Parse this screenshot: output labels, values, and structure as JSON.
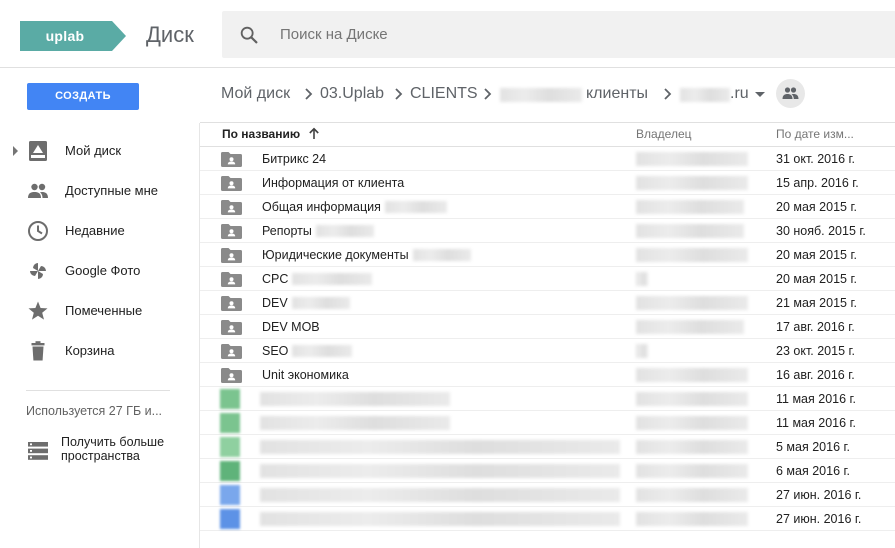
{
  "header": {
    "logo_text": "uplab",
    "app_title": "Диск",
    "search_placeholder": "Поиск на Диске",
    "colors": {
      "logo": "#5aaba5",
      "primary": "#4285f4",
      "icon": "#757575"
    }
  },
  "create_button": "СОЗДАТЬ",
  "sidebar": {
    "items": [
      {
        "label": "Мой диск",
        "icon": "drive-icon"
      },
      {
        "label": "Доступные мне",
        "icon": "shared-people-icon"
      },
      {
        "label": "Недавние",
        "icon": "clock-icon"
      },
      {
        "label": "Google Фото",
        "icon": "photos-pinwheel-icon"
      },
      {
        "label": "Помеченные",
        "icon": "star-icon"
      },
      {
        "label": "Корзина",
        "icon": "trash-icon"
      }
    ],
    "storage_text": "Используется 27 ГБ и...",
    "upgrade_label": "Получить больше пространства"
  },
  "breadcrumb": {
    "items": [
      "Мой диск",
      "03.Uplab",
      "CLIENTS",
      "клиенты",
      ".ru"
    ]
  },
  "list": {
    "headers": {
      "name": "По названию",
      "owner": "Владелец",
      "date": "По дате изм..."
    },
    "folders": [
      {
        "name": "Битрикс 24",
        "date": "31 окт. 2016 г."
      },
      {
        "name": "Информация от клиента",
        "date": "15 апр. 2016 г."
      },
      {
        "name": "Общая информация",
        "date": "20 мая 2015 г."
      },
      {
        "name": "Репорты",
        "date": "30 нояб. 2015 г."
      },
      {
        "name": "Юридические документы",
        "date": "20 мая 2015 г."
      },
      {
        "name": "CPC",
        "date": "20 мая 2015 г."
      },
      {
        "name": "DEV",
        "date": "21 мая 2015 г."
      },
      {
        "name": "DEV MOB",
        "date": "17 авг. 2016 г."
      },
      {
        "name": "SEO",
        "date": "23 окт. 2015 г."
      },
      {
        "name": "Unit экономика",
        "date": "16 авг. 2016 г."
      }
    ],
    "files": [
      {
        "date": "11 мая 2016 г.",
        "thumb": "#7bc48f"
      },
      {
        "date": "11 мая 2016 г.",
        "thumb": "#7bc48f"
      },
      {
        "date": "5 мая 2016 г.",
        "thumb": "#8fd0a0"
      },
      {
        "date": "6 мая 2016 г.",
        "thumb": "#5fb37a"
      },
      {
        "date": "27 июн. 2016 г.",
        "thumb": "#7aa7ec"
      },
      {
        "date": "27 июн. 2016 г.",
        "thumb": "#5d92e6"
      }
    ]
  }
}
